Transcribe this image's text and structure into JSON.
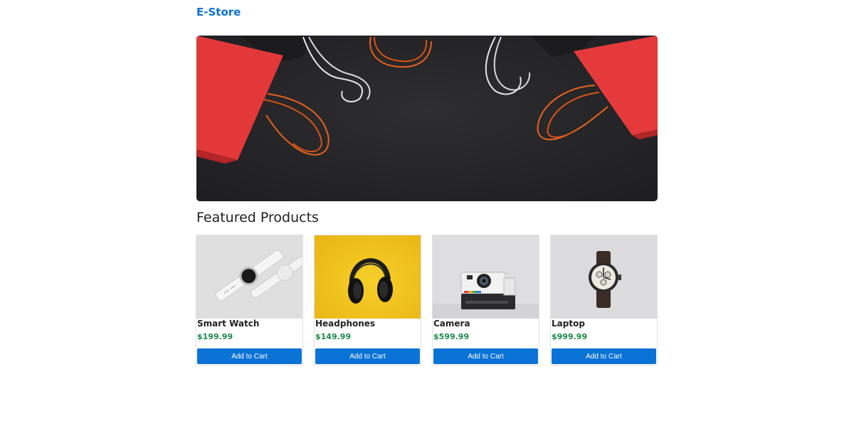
{
  "header": {
    "brand": "E-Store"
  },
  "hero": {
    "image": "shopping-bags-banner"
  },
  "featured": {
    "title": "Featured Products",
    "products": [
      {
        "name": "Smart Watch",
        "price": "$199.99",
        "button": "Add to Cart",
        "image": "smart-watch-photo"
      },
      {
        "name": "Headphones",
        "price": "$149.99",
        "button": "Add to Cart",
        "image": "headphones-photo"
      },
      {
        "name": "Camera",
        "price": "$599.99",
        "button": "Add to Cart",
        "image": "camera-photo"
      },
      {
        "name": "Laptop",
        "price": "$999.99",
        "button": "Add to Cart",
        "image": "chronograph-watch-photo"
      }
    ]
  },
  "colors": {
    "brand": "#0b72d6",
    "price": "#1a8a4a",
    "button": "#0b72d6"
  }
}
